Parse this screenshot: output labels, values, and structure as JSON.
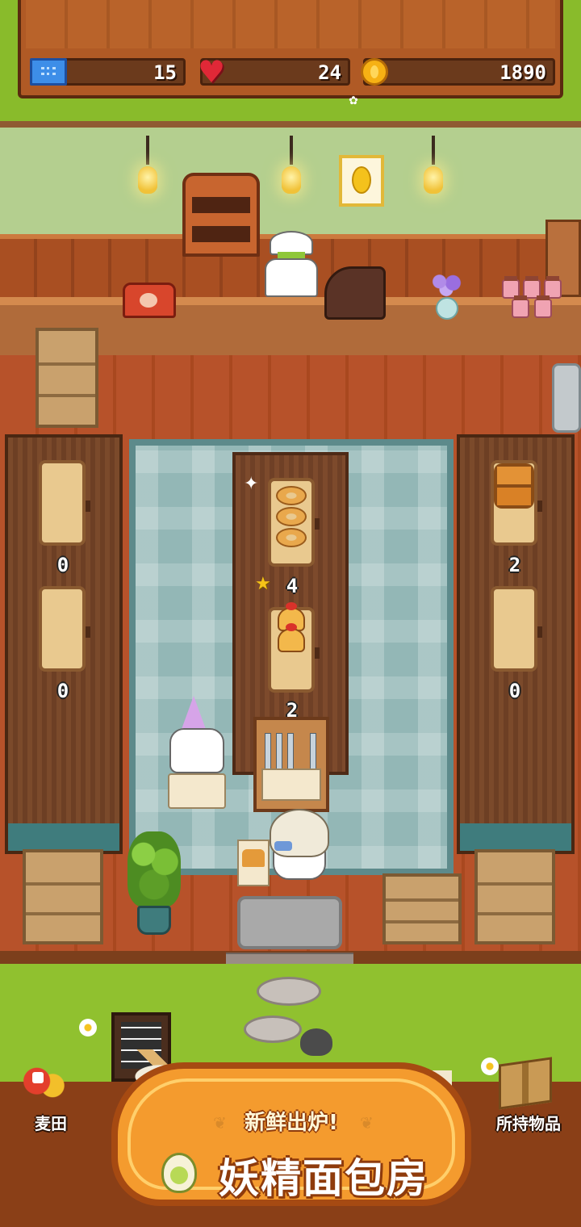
{
  "hud": {
    "tickets": "15",
    "hearts": "24",
    "coins": "1890"
  },
  "shop": {
    "left_case": {
      "top_count": "0",
      "bottom_count": "0"
    },
    "right_case": {
      "top_count": "2",
      "bottom_count": "0"
    },
    "center_table": {
      "rating_value": "4",
      "bottom_count": "2"
    }
  },
  "bottom_nav": {
    "left_label": "麦田",
    "right_label": "所持物品"
  },
  "sign": {
    "tagline": "新鲜出炉!",
    "title": "妖精面包房"
  },
  "colors": {
    "grass": "#89bb2b",
    "wood": "#b05a25",
    "rug": "#93b7b6",
    "sign_orange": "#f49b2e"
  },
  "icons": [
    "ticket-icon",
    "heart-icon",
    "coin-icon",
    "star-icon",
    "sparkle-icon",
    "wheat-icon",
    "box-icon",
    "flask-icon"
  ]
}
